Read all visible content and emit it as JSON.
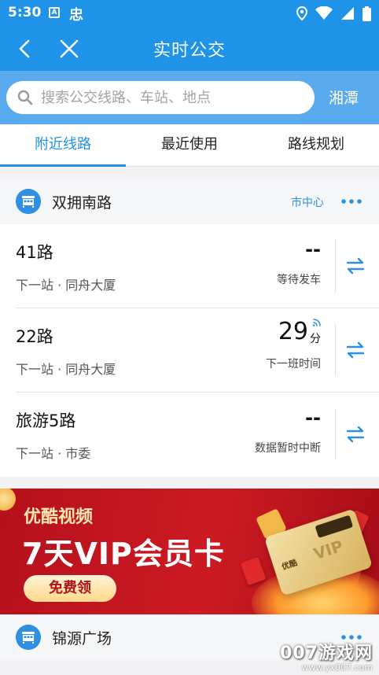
{
  "status_bar": {
    "time": "5:30",
    "notif_a": "A",
    "notif_b": "忠"
  },
  "app_bar": {
    "title": "实时公交"
  },
  "search": {
    "placeholder": "搜索公交线路、车站、地点",
    "city": "湘潭"
  },
  "tabs": [
    {
      "label": "附近线路",
      "active": true
    },
    {
      "label": "最近使用",
      "active": false
    },
    {
      "label": "路线规划",
      "active": false
    }
  ],
  "stations": [
    {
      "name": "双拥南路",
      "direction": "市中心",
      "routes": [
        {
          "name": "41路",
          "next": "下一站 · 同舟大厦",
          "eta": "--",
          "eta_unit": "",
          "status": "等待发车"
        },
        {
          "name": "22路",
          "next": "下一站 · 同舟大厦",
          "eta": "29",
          "eta_unit": "分",
          "status": "下一班时间"
        },
        {
          "name": "旅游5路",
          "next": "下一站 · 市委",
          "eta": "--",
          "eta_unit": "",
          "status": "数据暂时中断"
        }
      ]
    },
    {
      "name": "锦源广场",
      "direction": "",
      "routes": []
    }
  ],
  "banner": {
    "brand": "优酷视频",
    "offer": "7天VIP会员卡",
    "cta": "免费领",
    "card_logo": "优酷",
    "card_text": "VIP"
  },
  "watermark": {
    "big": "007游戏网",
    "small": "www.yx007.com"
  },
  "colors": {
    "primary": "#1e93e8",
    "search_bg": "#5aabee",
    "banner_red": "#c8161f"
  }
}
